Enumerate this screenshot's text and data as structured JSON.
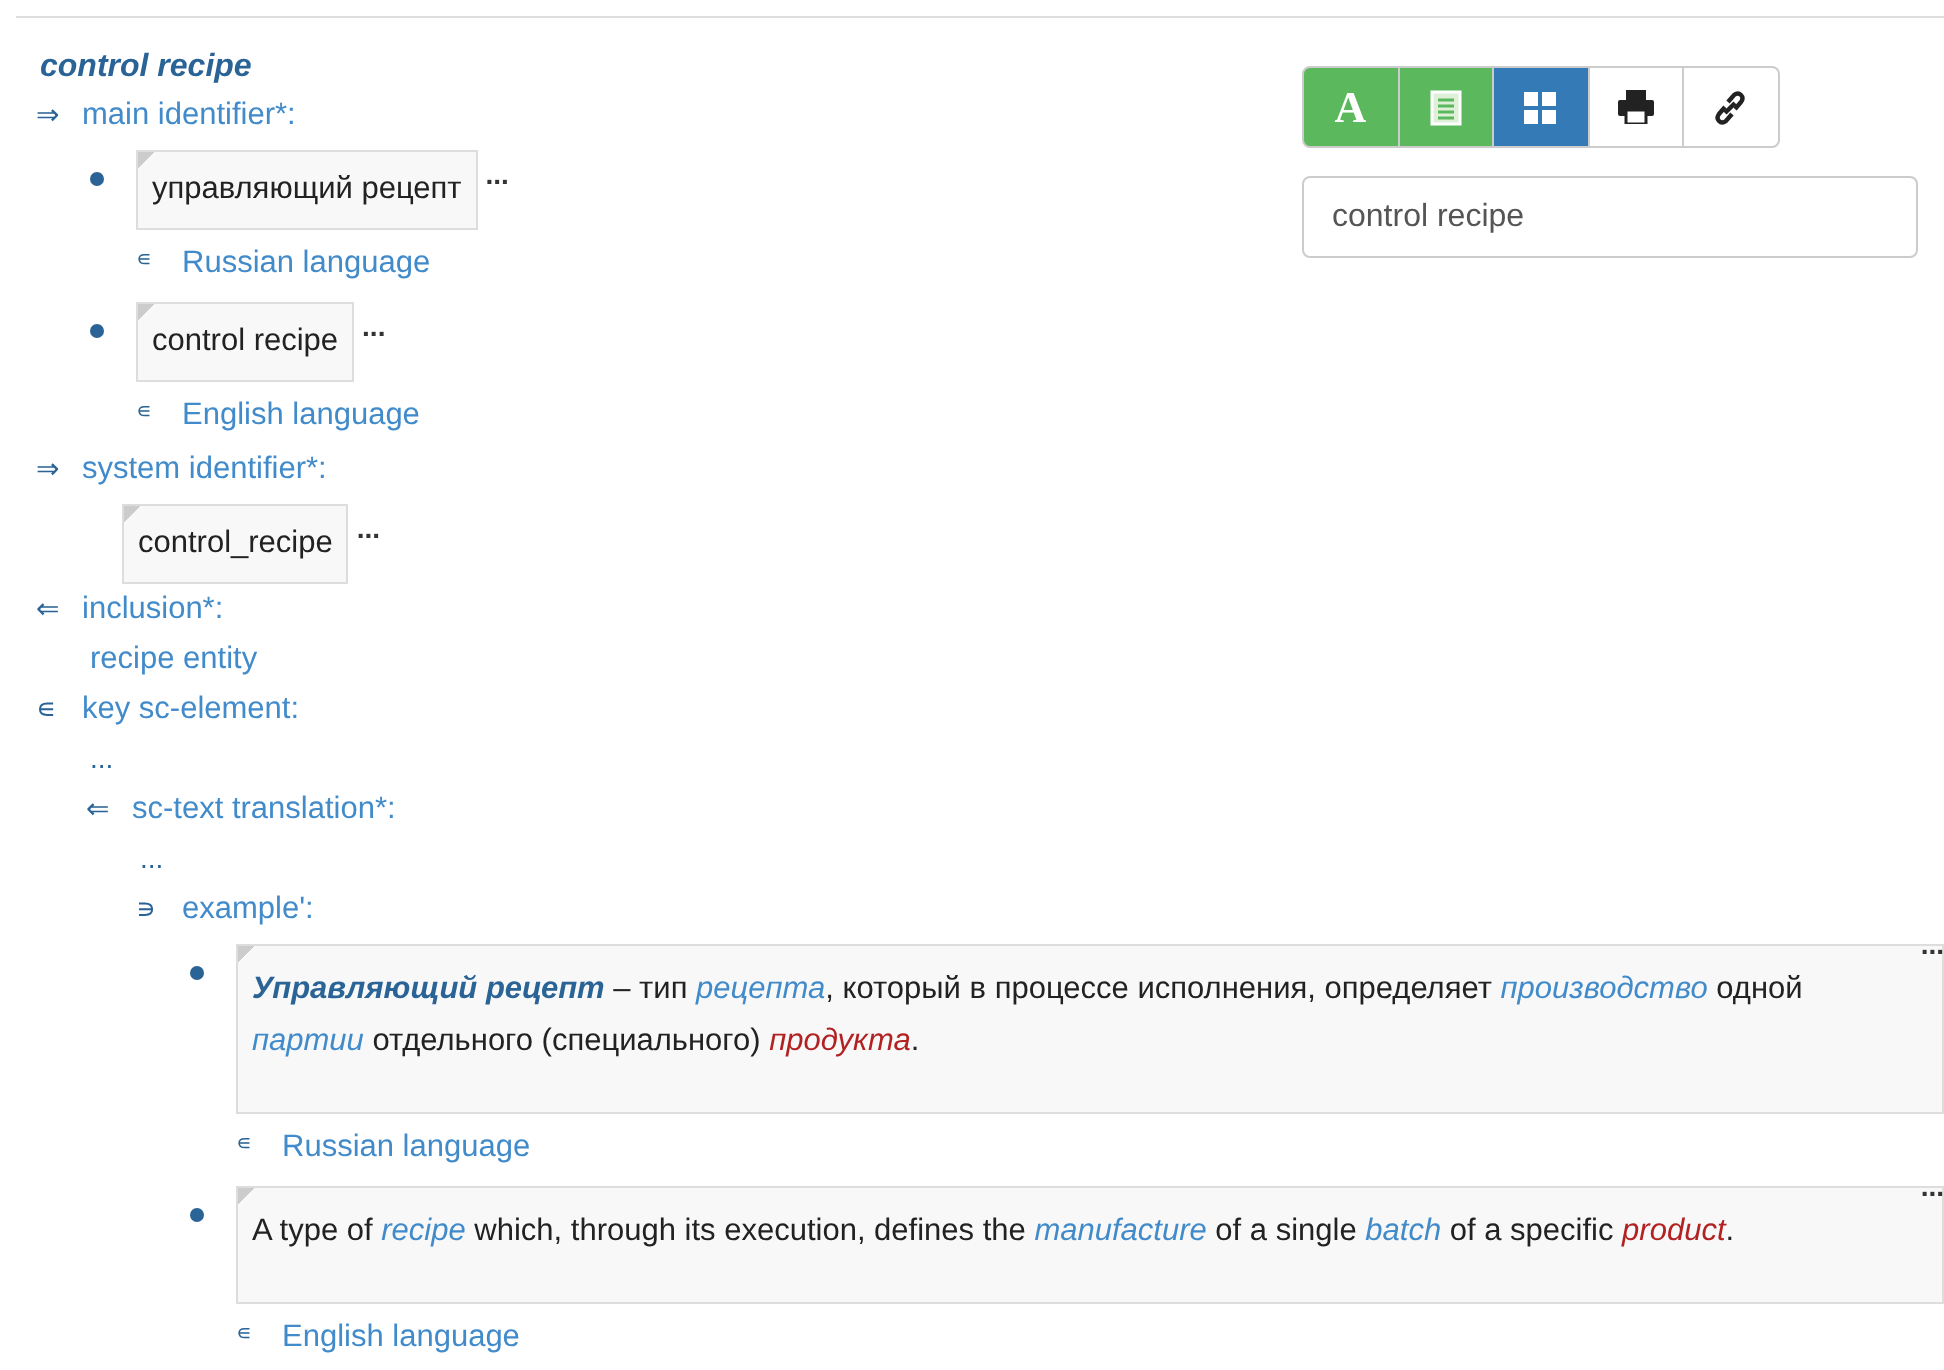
{
  "title": "control recipe",
  "toolbar": {
    "buttons": [
      {
        "kind": "letter",
        "label": "A",
        "color": "#5cb85c"
      },
      {
        "kind": "table",
        "color": "#5cb85c"
      },
      {
        "kind": "grid",
        "color": "#337ab7"
      },
      {
        "kind": "print",
        "color": "#ffffff"
      },
      {
        "kind": "link",
        "color": "#ffffff"
      }
    ]
  },
  "search": {
    "value": "control recipe"
  },
  "relations": [
    {
      "kind": "relation",
      "arrow": "⇒",
      "label": "main identifier*:",
      "children": [
        {
          "kind": "item",
          "bullet": true,
          "box": "управляющий рецепт",
          "more": "...",
          "language": {
            "marker": "∊",
            "label": "Russian language"
          }
        },
        {
          "kind": "item",
          "bullet": true,
          "box": "control recipe",
          "more": "...",
          "language": {
            "marker": "∊",
            "label": "English language"
          }
        }
      ]
    },
    {
      "kind": "relation",
      "arrow": "⇒",
      "label": "system identifier*:",
      "children": [
        {
          "kind": "item",
          "bullet": false,
          "box": "control_recipe",
          "more": "..."
        }
      ]
    },
    {
      "kind": "relation",
      "arrow": "⇐",
      "label": "inclusion*:",
      "children": [
        {
          "kind": "link",
          "label": "recipe entity"
        }
      ]
    },
    {
      "kind": "relation",
      "arrow": "∊",
      "label": "key sc-element:",
      "children": [
        {
          "kind": "ellipsis",
          "text": "..."
        },
        {
          "kind": "relation",
          "arrow": "⇐",
          "label": "sc-text translation*:",
          "children": [
            {
              "kind": "ellipsis",
              "text": "..."
            },
            {
              "kind": "relation",
              "arrow": "∍",
              "label": "example':",
              "children": [
                {
                  "kind": "item",
                  "bullet": true,
                  "more": "...",
                  "paragraph": [
                    {
                      "kind": "strong",
                      "text": "Управляющий рецепт"
                    },
                    {
                      "kind": "plain",
                      "text": " – тип "
                    },
                    {
                      "kind": "term",
                      "text": "рецепта"
                    },
                    {
                      "kind": "plain",
                      "text": ", который в процессе исполнения, определяет "
                    },
                    {
                      "kind": "term",
                      "text": "производство"
                    },
                    {
                      "kind": "plain",
                      "text": " одной "
                    },
                    {
                      "kind": "term",
                      "text": "партии"
                    },
                    {
                      "kind": "plain",
                      "text": " отдельного (специального) "
                    },
                    {
                      "kind": "missing",
                      "text": "продукта"
                    },
                    {
                      "kind": "plain",
                      "text": "."
                    }
                  ],
                  "language": {
                    "marker": "∊",
                    "label": "Russian language"
                  }
                },
                {
                  "kind": "item",
                  "bullet": true,
                  "more": "...",
                  "paragraph": [
                    {
                      "kind": "plain",
                      "text": "A type of "
                    },
                    {
                      "kind": "term",
                      "text": "recipe"
                    },
                    {
                      "kind": "plain",
                      "text": " which, through its execution, defines the "
                    },
                    {
                      "kind": "term",
                      "text": "manufacture"
                    },
                    {
                      "kind": "plain",
                      "text": " of a single "
                    },
                    {
                      "kind": "term",
                      "text": "batch"
                    },
                    {
                      "kind": "plain",
                      "text": " of a specific "
                    },
                    {
                      "kind": "missing",
                      "text": "product"
                    },
                    {
                      "kind": "plain",
                      "text": "."
                    }
                  ],
                  "language": {
                    "marker": "∊",
                    "label": "English language"
                  }
                }
              ]
            }
          ]
        }
      ]
    }
  ]
}
